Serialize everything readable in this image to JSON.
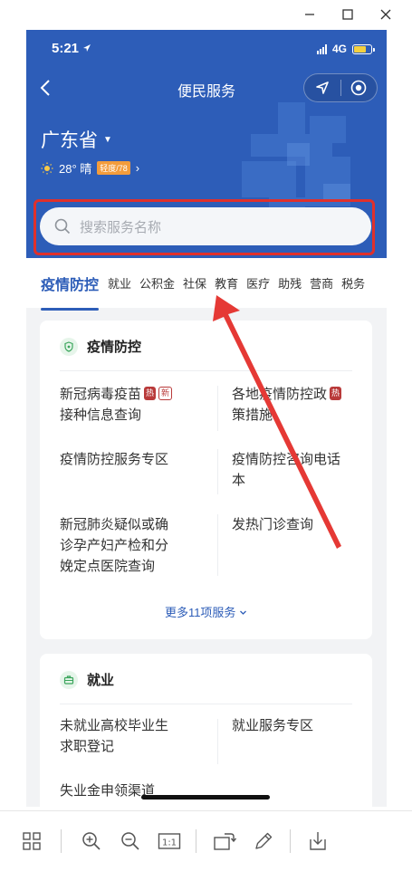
{
  "window_controls": {
    "minimize": "—",
    "maximize": "☐",
    "close": "✕"
  },
  "status_bar": {
    "time": "5:21",
    "network": "4G"
  },
  "navbar": {
    "title": "便民服务"
  },
  "location": {
    "region": "广东省",
    "caret": "▼"
  },
  "weather": {
    "temp": "28° 晴",
    "aqi": "轻度/78",
    "chevron": "›"
  },
  "search": {
    "placeholder": "搜索服务名称"
  },
  "tabs": [
    "疫情防控",
    "就业",
    "公积金",
    "社保",
    "教育",
    "医疗",
    "助残",
    "营商",
    "税务"
  ],
  "colors": {
    "header_blue": "#2d5db8",
    "highlight_red": "#e0302b",
    "hot_badge": "#b93a3a"
  },
  "cards": {
    "epidemic": {
      "title": "疫情防控",
      "icon": "shield-icon",
      "services": [
        {
          "line1": "新冠病毒疫苗",
          "line2": "接种信息查询",
          "badges": [
            "热",
            "新"
          ]
        },
        {
          "line1": "各地疫情防控政",
          "line2": "策措施",
          "badges": [
            "热"
          ]
        },
        {
          "line1": "疫情防控服务专区",
          "line2": ""
        },
        {
          "line1": "疫情防控咨询电话",
          "line2": "本"
        },
        {
          "line1": "新冠肺炎疑似或确",
          "line2": "诊孕产妇产检和分",
          "line3": "娩定点医院查询"
        },
        {
          "line1": "发热门诊查询",
          "line2": ""
        }
      ],
      "more": "更多11项服务"
    },
    "employment": {
      "title": "就业",
      "icon": "briefcase-icon",
      "services": [
        {
          "line1": "未就业高校毕业生",
          "line2": "求职登记"
        },
        {
          "line1": "就业服务专区",
          "line2": ""
        },
        {
          "line1": "失业金申领渠道",
          "line2": ""
        }
      ]
    }
  },
  "toolbar": [
    "grid-icon",
    "zoom-in-icon",
    "zoom-out-icon",
    "actual-size-icon",
    "rotate-icon",
    "edit-icon",
    "download-icon"
  ],
  "toolbar_labels": {
    "actual_size": "1:1"
  }
}
